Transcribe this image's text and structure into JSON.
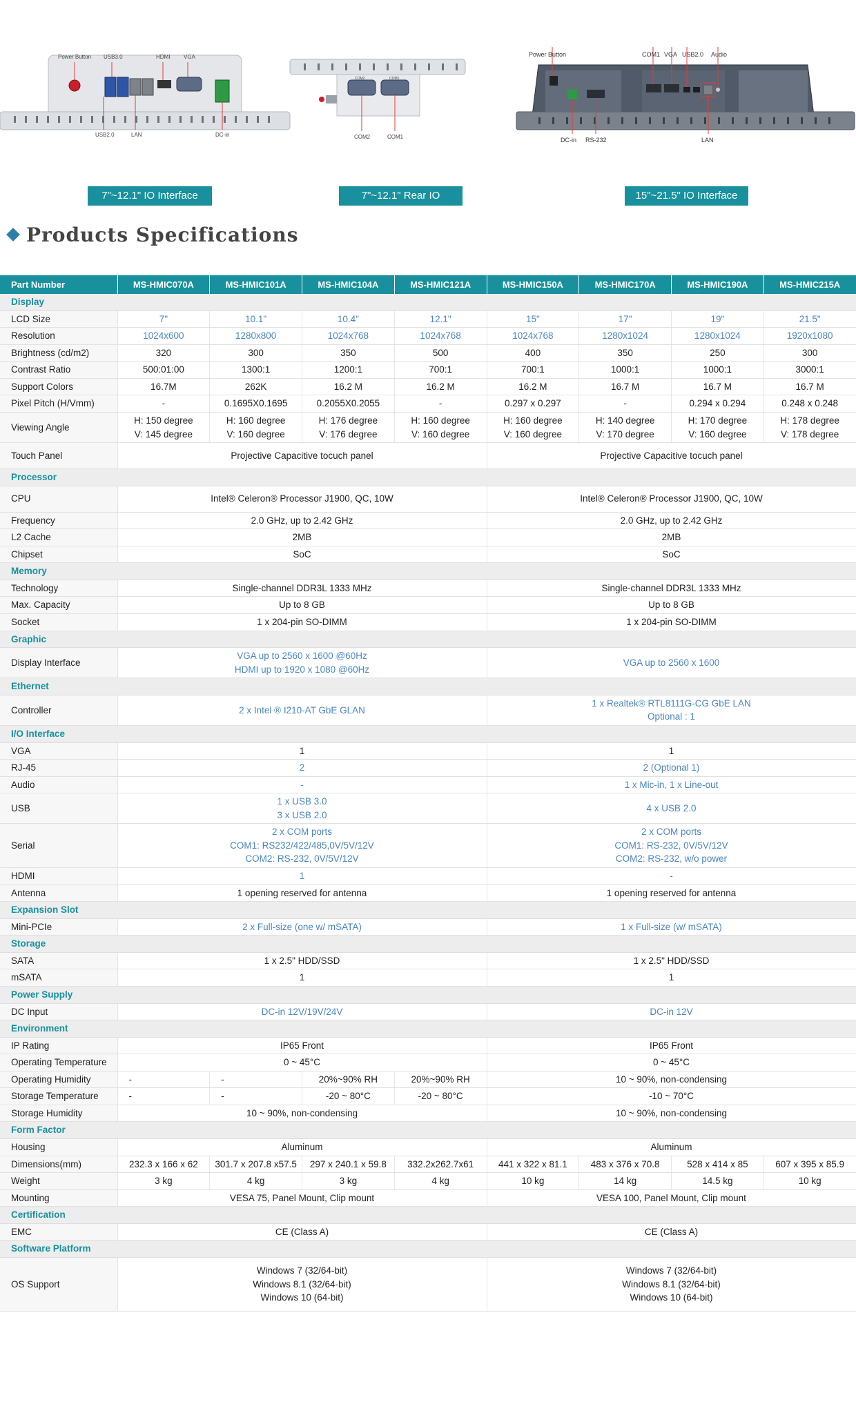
{
  "io": {
    "pic1": {
      "labels": [
        "Power Button",
        "USB3.0",
        "HDMI",
        "VGA",
        "USB2.0",
        "LAN",
        "DC-in"
      ]
    },
    "pic2": {
      "labels": [
        "COM2",
        "COM1",
        "COM2",
        "COM1"
      ]
    },
    "pic3": {
      "labels": [
        "Power Button",
        "COM1",
        "VGA",
        "USB2.0",
        "Audio",
        "DC-in",
        "RS-232",
        "LAN"
      ]
    },
    "buttons": [
      "7\"~12.1\" IO Interface",
      "7\"~12.1\" Rear IO",
      "15\"~21.5\"  IO Interface"
    ]
  },
  "heading": "Products Specifications",
  "table": {
    "header": [
      "Part Number",
      "MS-HMIC070A",
      "MS-HMIC101A",
      "MS-HMIC104A",
      "MS-HMIC121A",
      "MS-HMIC150A",
      "MS-HMIC170A",
      "MS-HMIC190A",
      "MS-HMIC215A"
    ],
    "rows": [
      {
        "section": "Display"
      },
      {
        "label": "LCD Size",
        "blue": true,
        "cells": [
          "7\"",
          "10.1\"",
          "10.4\"",
          "12.1\"",
          "15\"",
          "17\"",
          "19\"",
          "21.5\""
        ]
      },
      {
        "label": "Resolution",
        "blue": true,
        "cells": [
          "1024x600",
          "1280x800",
          "1024x768",
          "1024x768",
          "1024x768",
          "1280x1024",
          "1280x1024",
          "1920x1080"
        ]
      },
      {
        "label": "Brightness (cd/m2)",
        "cells": [
          "320",
          "300",
          "350",
          "500",
          "400",
          "350",
          "250",
          "300"
        ]
      },
      {
        "label": "Contrast Ratio",
        "cells": [
          "500:01:00",
          "1300:1",
          "1200:1",
          "700:1",
          "700:1",
          "1000:1",
          "1000:1",
          "3000:1"
        ]
      },
      {
        "label": "Support Colors",
        "cells": [
          "16.7M",
          "262K",
          "16.2 M",
          "16.2 M",
          "16.2 M",
          "16.7 M",
          "16.7 M",
          "16.7 M"
        ]
      },
      {
        "label": "Pixel Pitch (H/Vmm)",
        "cells": [
          "-",
          "0.1695X0.1695",
          "0.2055X0.2055",
          "-",
          "0.297 x 0.297",
          "-",
          "0.294 x 0.294",
          "0.248 x 0.248"
        ]
      },
      {
        "label": "Viewing Angle",
        "cells": [
          "H: 150 degree\nV: 145 degree",
          "H: 160 degree\nV: 160 degree",
          "H: 176 degree\nV: 176 degree",
          "H: 160 degree\nV: 160 degree",
          "H: 160 degree\nV: 160 degree",
          "H: 140 degree\nV: 170 degree",
          "H: 170 degree\nV: 160 degree",
          "H: 178 degree\nV: 178 degree"
        ]
      },
      {
        "label": "Touch Panel",
        "tall": true,
        "halves": [
          "Projective Capacitive tocuch panel",
          "Projective Capacitive tocuch panel"
        ]
      },
      {
        "section": "Processor"
      },
      {
        "label": "CPU",
        "tall": true,
        "halves": [
          "Intel® Celeron® Processor J1900, QC, 10W",
          "Intel® Celeron® Processor J1900, QC, 10W"
        ]
      },
      {
        "label": "Frequency",
        "halves": [
          "2.0 GHz, up to 2.42 GHz",
          "2.0 GHz, up to 2.42 GHz"
        ]
      },
      {
        "label": "L2 Cache",
        "halves": [
          "2MB",
          "2MB"
        ]
      },
      {
        "label": "Chipset",
        "halves": [
          "SoC",
          "SoC"
        ]
      },
      {
        "section": "Memory"
      },
      {
        "label": "Technology",
        "halves": [
          "Single-channel DDR3L 1333 MHz",
          "Single-channel DDR3L 1333 MHz"
        ]
      },
      {
        "label": "Max. Capacity",
        "halves": [
          "Up to 8 GB",
          "Up to 8 GB"
        ]
      },
      {
        "label": "Socket",
        "halves": [
          "1 x 204-pin SO-DIMM",
          "1 x 204-pin SO-DIMM"
        ]
      },
      {
        "section": "Graphic"
      },
      {
        "label": "Display Interface",
        "blue": true,
        "halves": [
          "VGA up to 2560 x 1600 @60Hz\nHDMI up to 1920 x 1080 @60Hz",
          "VGA up to 2560 x 1600"
        ]
      },
      {
        "section": "Ethernet"
      },
      {
        "label": "Controller",
        "blue": true,
        "halves": [
          "2 x Intel ®  I210-AT GbE GLAN",
          "1 x Realtek® RTL8111G-CG GbE LAN\nOptional : 1"
        ]
      },
      {
        "section": "I/O Interface"
      },
      {
        "label": "VGA",
        "halves": [
          "1",
          "1"
        ]
      },
      {
        "label": "RJ-45",
        "blue": true,
        "halves": [
          "2",
          "2 (Optional 1)"
        ]
      },
      {
        "label": "Audio",
        "blue": true,
        "halves": [
          "-",
          "1 x Mic-in, 1 x Line-out"
        ]
      },
      {
        "label": "USB",
        "blue": true,
        "halves": [
          "1 x USB 3.0\n3 x USB 2.0",
          "4 x USB 2.0"
        ]
      },
      {
        "label": "Serial",
        "blue": true,
        "halves": [
          "2 x COM ports\nCOM1: RS232/422/485,0V/5V/12V\nCOM2: RS-232, 0V/5V/12V",
          "2 x COM ports\nCOM1: RS-232, 0V/5V/12V\nCOM2: RS-232, w/o power"
        ]
      },
      {
        "label": "HDMI",
        "blue": true,
        "halves": [
          "1",
          "-"
        ]
      },
      {
        "label": "Antenna",
        "halves": [
          "1 opening reserved for antenna",
          "1 opening reserved for antenna"
        ]
      },
      {
        "section": "Expansion Slot"
      },
      {
        "label": "Mini-PCIe",
        "blue": true,
        "halves": [
          "2 x Full-size (one w/ mSATA)",
          "1 x Full-size (w/ mSATA)"
        ]
      },
      {
        "section": "Storage"
      },
      {
        "label": "SATA",
        "halves": [
          "1 x 2.5\" HDD/SSD",
          "1 x 2.5\" HDD/SSD"
        ]
      },
      {
        "label": "mSATA",
        "halves": [
          "1",
          "1"
        ]
      },
      {
        "section": "Power Supply"
      },
      {
        "label": "DC Input",
        "blue": true,
        "halves": [
          "DC-in 12V/19V/24V",
          "DC-in 12V"
        ]
      },
      {
        "section": "Environment"
      },
      {
        "label": "IP Rating",
        "halves": [
          "IP65 Front",
          "IP65 Front"
        ]
      },
      {
        "label": "Operating Temperature",
        "halves": [
          "0 ~ 45°C",
          "0 ~ 45°C"
        ]
      },
      {
        "label": "Operating Humidity",
        "mixed": [
          "-",
          "-",
          "20%~90% RH",
          "20%~90% RH"
        ],
        "right": "10 ~ 90%, non-condensing"
      },
      {
        "label": "Storage Temperature",
        "mixed": [
          "-",
          "-",
          "-20 ~ 80°C",
          "-20 ~ 80°C"
        ],
        "right": "-10 ~ 70°C"
      },
      {
        "label": "Storage Humidity",
        "halves": [
          "10 ~ 90%, non-condensing",
          "10 ~ 90%, non-condensing"
        ]
      },
      {
        "section": "Form Factor"
      },
      {
        "label": "Housing",
        "halves": [
          "Aluminum",
          "Aluminum"
        ]
      },
      {
        "label": "Dimensions(mm)",
        "cells": [
          "232.3 x 166 x 62",
          "301.7 x 207.8 x57.5",
          "297 x 240.1 x 59.8",
          "332.2x262.7x61",
          "441 x 322 x 81.1",
          "483 x 376 x 70.8",
          "528 x 414 x 85",
          "607 x 395 x 85.9"
        ]
      },
      {
        "label": "Weight",
        "cells": [
          "3 kg",
          "4 kg",
          "3 kg",
          "4 kg",
          "10 kg",
          "14 kg",
          "14.5 kg",
          "10 kg"
        ]
      },
      {
        "label": "Mounting",
        "halves": [
          "VESA 75, Panel Mount, Clip mount",
          "VESA 100, Panel Mount, Clip mount"
        ]
      },
      {
        "section": "Certification"
      },
      {
        "label": "EMC",
        "halves": [
          "CE (Class A)",
          "CE (Class A)"
        ]
      },
      {
        "section": "Software Platform"
      },
      {
        "label": "OS Support",
        "halves": [
          "Windows 7 (32/64-bit)\nWindows 8.1 (32/64-bit)\nWindows 10 (64-bit)",
          "Windows 7 (32/64-bit)\nWindows 8.1 (32/64-bit)\nWindows 10 (64-bit)"
        ]
      }
    ]
  }
}
